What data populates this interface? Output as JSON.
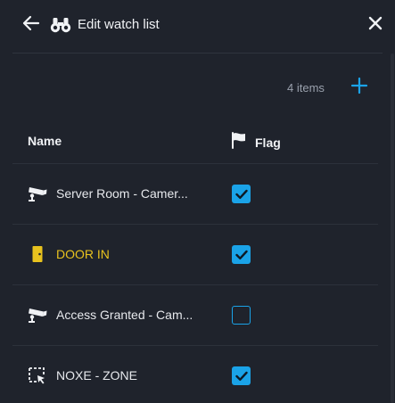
{
  "header": {
    "title": "Edit watch list",
    "back_icon": "arrow-left-icon",
    "title_icon": "binoculars-icon",
    "close_icon": "close-icon"
  },
  "toolbar": {
    "count_label": "4 items",
    "add_icon": "plus-icon"
  },
  "table": {
    "columns": {
      "name": "Name",
      "flag": "Flag"
    },
    "rows": [
      {
        "icon": "camera-icon",
        "name": "Server Room - Camer...",
        "flagged": true,
        "color": "#e6e8ec"
      },
      {
        "icon": "door-icon",
        "name": "DOOR IN",
        "flagged": true,
        "color": "#e8c21e"
      },
      {
        "icon": "camera-icon",
        "name": "Access Granted - Cam...",
        "flagged": false,
        "color": "#e6e8ec"
      },
      {
        "icon": "zone-icon",
        "name": "NOXE - ZONE",
        "flagged": true,
        "color": "#e6e8ec"
      }
    ]
  },
  "colors": {
    "background": "#1f232c",
    "accent": "#1aa3e8",
    "door": "#e8c21e"
  }
}
